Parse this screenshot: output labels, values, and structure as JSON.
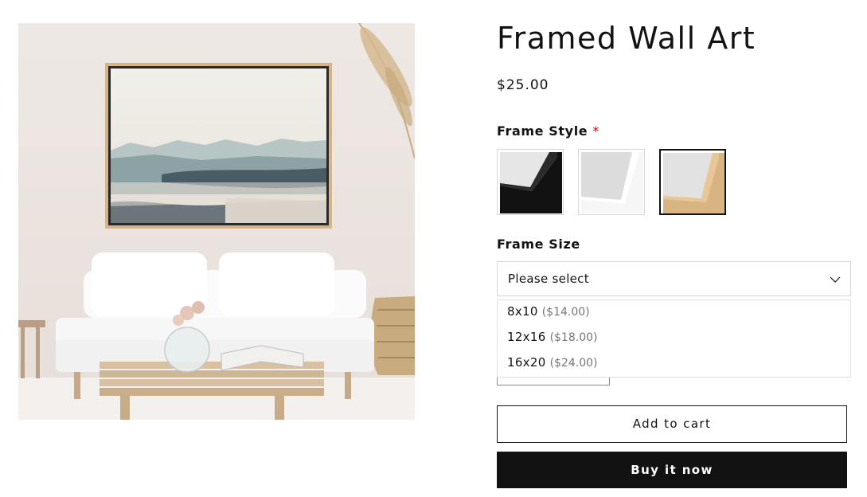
{
  "product": {
    "title": "Framed Wall Art",
    "price": "$25.00",
    "image_alt": "Framed abstract landscape painting above a white sofa"
  },
  "frame_style": {
    "label": "Frame Style",
    "required_mark": "*",
    "options": [
      {
        "name": "black-frame",
        "color": "#111111",
        "selected": false
      },
      {
        "name": "white-frame",
        "color": "#f4f4f4",
        "selected": false
      },
      {
        "name": "natural-wood-frame",
        "color": "#d8b480",
        "selected": true
      }
    ]
  },
  "frame_size": {
    "label": "Frame Size",
    "selected": "Please select",
    "options": [
      {
        "size": "8x10",
        "price": "($14.00)"
      },
      {
        "size": "12x16",
        "price": "($18.00)"
      },
      {
        "size": "16x20",
        "price": "($24.00)"
      }
    ]
  },
  "buttons": {
    "add_to_cart": "Add to cart",
    "buy_now": "Buy it now"
  },
  "colors": {
    "text": "#121212",
    "required": "#d10000",
    "buy_button_bg": "#121212",
    "border": "#d6d6d6"
  }
}
